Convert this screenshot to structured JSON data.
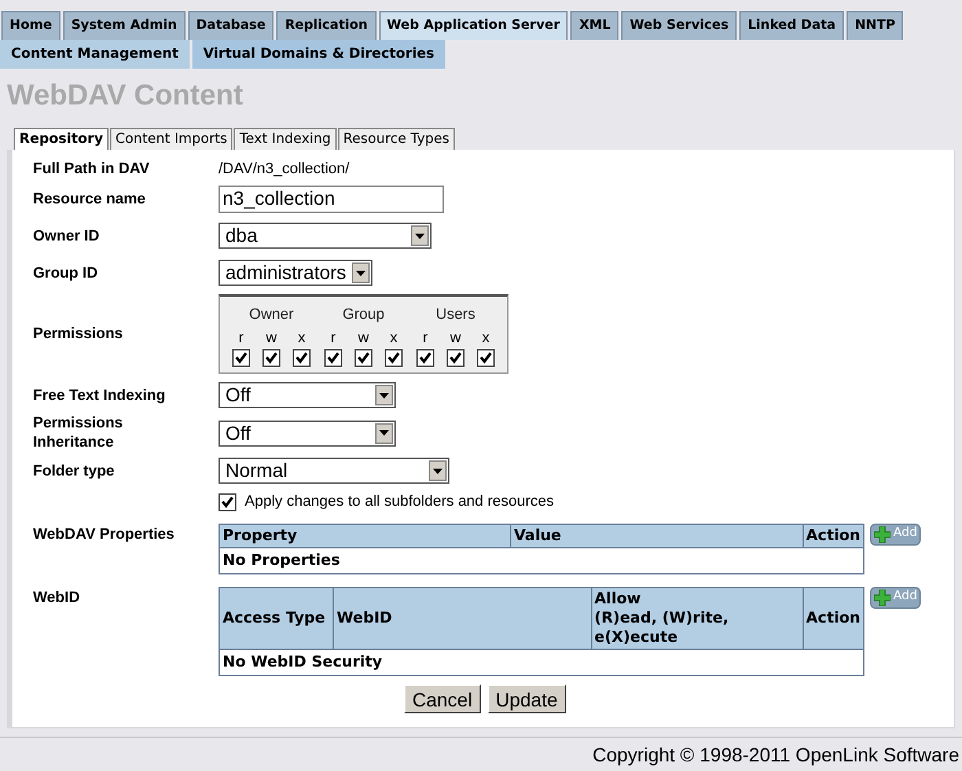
{
  "nav_primary": [
    {
      "label": "Home",
      "selected": false
    },
    {
      "label": "System Admin",
      "selected": false
    },
    {
      "label": "Database",
      "selected": false
    },
    {
      "label": "Replication",
      "selected": false
    },
    {
      "label": "Web Application Server",
      "selected": true
    },
    {
      "label": "XML",
      "selected": false
    },
    {
      "label": "Web Services",
      "selected": false
    },
    {
      "label": "Linked Data",
      "selected": false
    },
    {
      "label": "NNTP",
      "selected": false
    }
  ],
  "nav_secondary": [
    {
      "label": "Content Management",
      "selected": true
    },
    {
      "label": "Virtual Domains & Directories",
      "selected": false
    }
  ],
  "page_title": "WebDAV Content",
  "tabs": [
    {
      "label": "Repository",
      "selected": true
    },
    {
      "label": "Content Imports",
      "selected": false
    },
    {
      "label": "Text Indexing",
      "selected": false
    },
    {
      "label": "Resource Types",
      "selected": false
    }
  ],
  "fields": [
    {
      "kind": "text",
      "label": "Full Path in DAV",
      "value": "/DAV/n3_collection/"
    },
    {
      "kind": "input",
      "label": "Resource name",
      "value": "n3_collection"
    },
    {
      "kind": "select",
      "label": "Owner ID",
      "value": "dba"
    },
    {
      "kind": "select",
      "label": "Group ID",
      "value": "administrators"
    },
    {
      "kind": "permissions",
      "label": "Permissions",
      "groups": [
        {
          "name": "Owner",
          "bits": [
            {
              "label": "r",
              "checked": true
            },
            {
              "label": "w",
              "checked": true
            },
            {
              "label": "x",
              "checked": true
            }
          ]
        },
        {
          "name": "Group",
          "bits": [
            {
              "label": "r",
              "checked": true
            },
            {
              "label": "w",
              "checked": true
            },
            {
              "label": "x",
              "checked": true
            }
          ]
        },
        {
          "name": "Users",
          "bits": [
            {
              "label": "r",
              "checked": true
            },
            {
              "label": "w",
              "checked": true
            },
            {
              "label": "x",
              "checked": true
            }
          ]
        }
      ]
    },
    {
      "kind": "select",
      "label": "Free Text Indexing",
      "value": "Off"
    },
    {
      "kind": "select",
      "label": "Permissions Inheritance",
      "value": "Off"
    },
    {
      "kind": "select",
      "label": "Folder type",
      "value": "Normal"
    },
    {
      "kind": "checkbox",
      "label": "Apply changes to all subfolders and resources",
      "checked": true
    }
  ],
  "properties": {
    "label": "WebDAV Properties",
    "columns": [
      {
        "lines": [
          "Property"
        ]
      },
      {
        "lines": [
          "Value"
        ]
      },
      {
        "lines": [
          "Action"
        ]
      }
    ],
    "empty_text": "No Properties",
    "add_button": "Add"
  },
  "webid": {
    "label": "WebID",
    "columns": [
      {
        "lines": [
          "Access Type"
        ]
      },
      {
        "lines": [
          "WebID"
        ]
      },
      {
        "lines": [
          "Allow",
          "(R)ead, (W)rite, e(X)ecute"
        ]
      },
      {
        "lines": [
          "Action"
        ]
      }
    ],
    "empty_text": "No WebID Security",
    "add_button": "Add"
  },
  "buttons": [
    "Cancel",
    "Update"
  ],
  "footer": "Copyright © 1998-2011 OpenLink Software"
}
